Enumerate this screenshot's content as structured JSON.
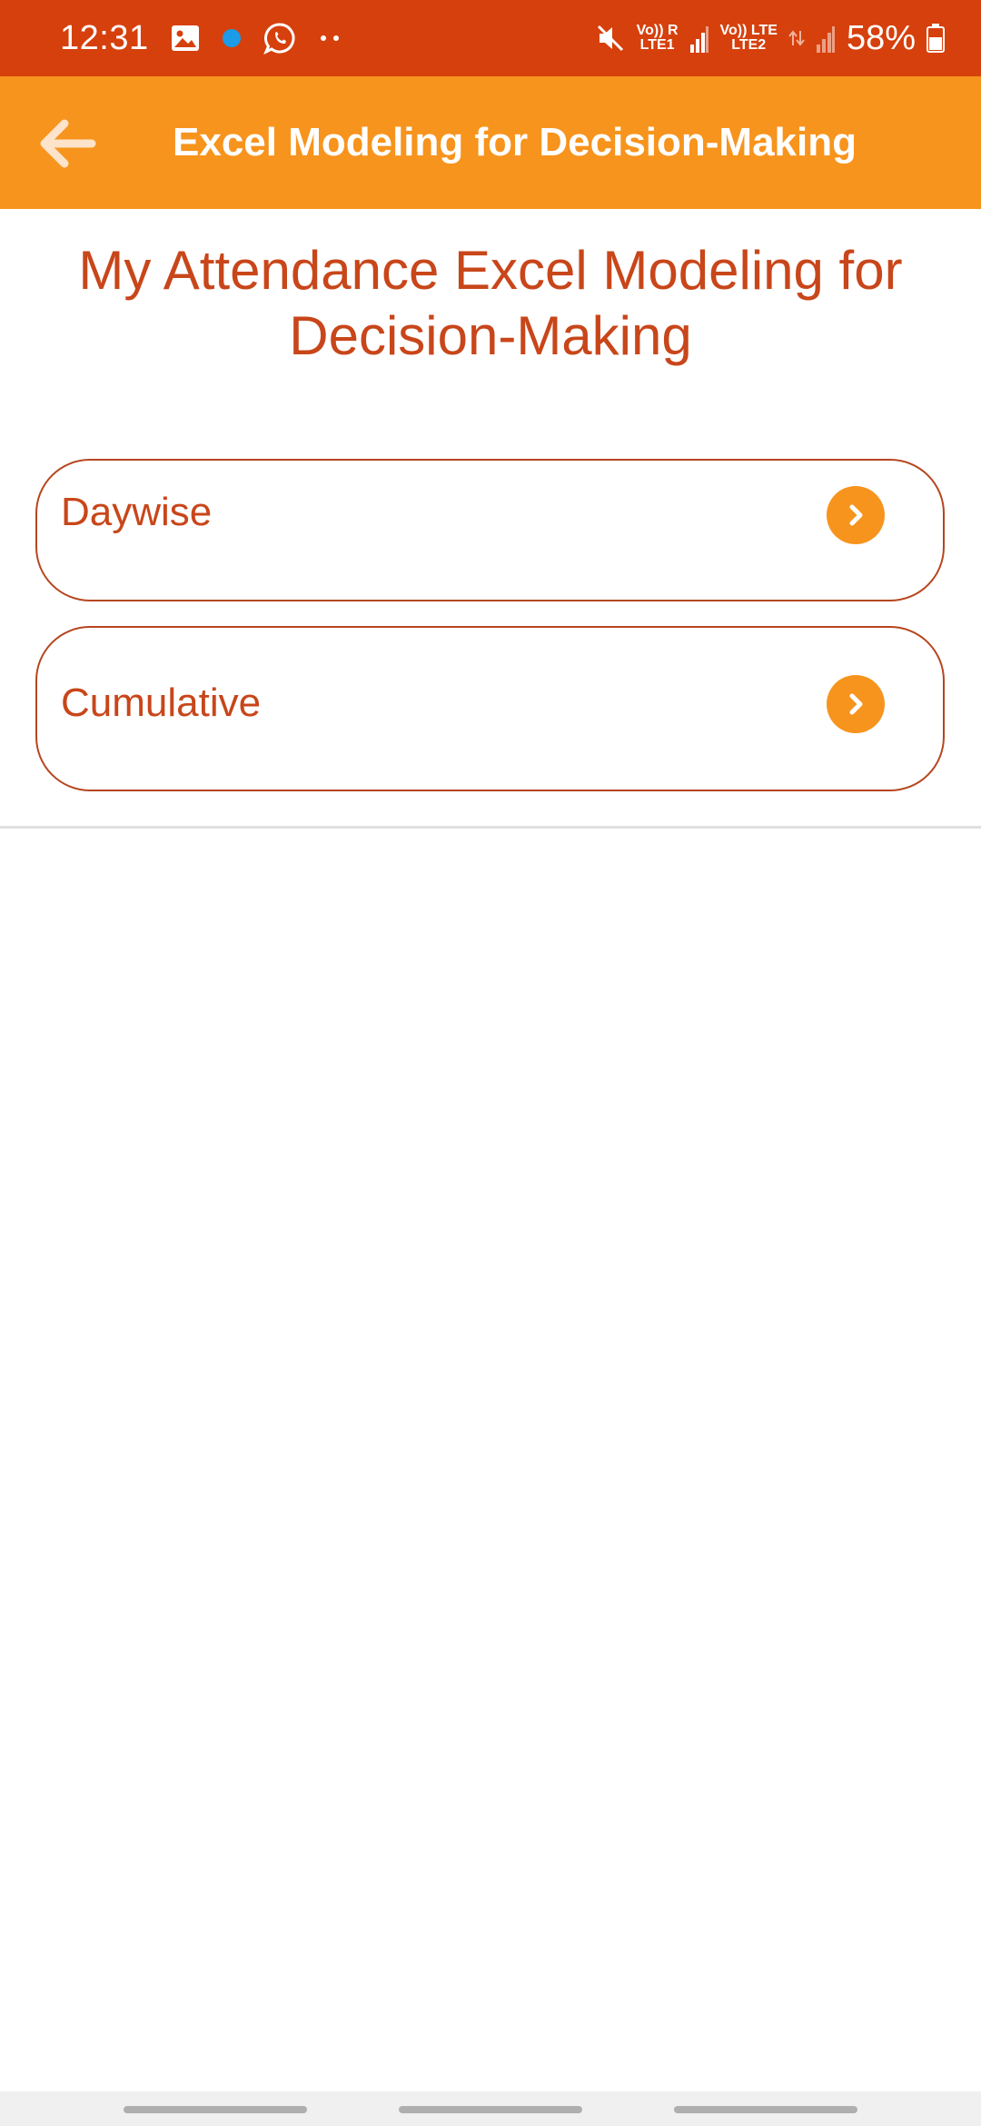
{
  "status_bar": {
    "time": "12:31",
    "left_icons": [
      "gallery-icon",
      "notification-dot-icon",
      "whatsapp-icon",
      "more-dots-icon"
    ],
    "sim1_top": "Vo)) R",
    "sim1_bottom": "LTE1",
    "sim2_top": "Vo)) LTE",
    "sim2_bottom": "LTE2",
    "battery": "58%",
    "colors": {
      "background": "#D6400C"
    }
  },
  "app_bar": {
    "title": "Excel Modeling for Decision-Making",
    "back_icon": "arrow-left-icon",
    "colors": {
      "background": "#F7941D"
    }
  },
  "page": {
    "title": "My Attendance Excel Modeling for Decision-Making"
  },
  "options": [
    {
      "label": "Daywise",
      "icon": "chevron-right-circle-icon"
    },
    {
      "label": "Cumulative",
      "icon": "chevron-right-circle-icon"
    }
  ],
  "theme": {
    "accent": "#F7941D",
    "text": "#C8461A",
    "border": "#B6461F"
  }
}
